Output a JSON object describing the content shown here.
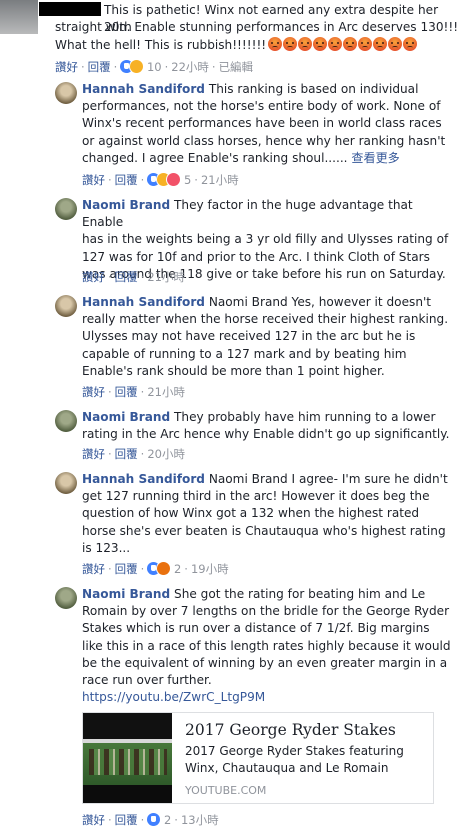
{
  "top_comment": {
    "text_line1": "This is pathetic! Winx not earned any extra despite her 20th",
    "text_line2": "straight win. Enable stunning performances in Arc deserves 130!!!!!!",
    "text_line3": "What the hell! This is rubbish!!!!!!!",
    "like": "讚好",
    "reply": "回覆",
    "reaction_count": "10",
    "time": "22小時",
    "edited": "已編輯"
  },
  "replies": [
    {
      "author": "Hannah Sandiford",
      "lines": [
        "This ranking is based on individual",
        "performances, not the horse's entire body of work. None of",
        "Winx's recent performances have been in world class races",
        "or against world class horses, hence why her ranking hasn't",
        "changed. I agree Enable's ranking shoul......"
      ],
      "see_more": "查看更多",
      "like": "讚好",
      "reply": "回覆",
      "reaction_count": "5",
      "time": "21小時"
    },
    {
      "author": "Naomi Brand",
      "lines": [
        "They factor in the huge advantage that Enable",
        "has in the weights being a 3 yr old filly and Ulysses rating of",
        "127 was for 10f and prior to the Arc. I think Cloth of Stars",
        "was around the 118 give or take before his run on Saturday."
      ],
      "like": "讚好",
      "reply": "回覆",
      "time": "21小時"
    },
    {
      "author": "Hannah Sandiford",
      "lines": [
        "Naomi Brand Yes, however it doesn't",
        "really matter when the horse received their highest ranking.",
        "Ulysses may not have received 127 in the arc but he is",
        "capable of running to a 127 mark and by beating him",
        "Enable's rank should be more than 1 point higher."
      ],
      "like": "讚好",
      "reply": "回覆",
      "time": "21小時"
    },
    {
      "author": "Naomi Brand",
      "lines": [
        "They probably have him running to a lower",
        "rating in the Arc hence why Enable didn't go up significantly."
      ],
      "like": "讚好",
      "reply": "回覆",
      "time": "20小時"
    },
    {
      "author": "Hannah Sandiford",
      "lines": [
        "Naomi Brand I agree- I'm sure he didn't",
        "get 127 running third in the arc! However it does beg the",
        "question of how Winx got a 132 when the highest rated",
        "horse she's ever beaten is Chautauqua who's highest rating",
        "is 123..."
      ],
      "like": "讚好",
      "reply": "回覆",
      "reaction_count": "2",
      "time": "19小時"
    },
    {
      "author": "Naomi Brand",
      "lines": [
        "She got the rating for beating him and Le",
        "Romain by over 7 lengths on the bridle for the George Ryder",
        "Stakes which is run over a distance of 7 1/2f. Big margins",
        "like this in a race of this length rates highly because it would",
        "be the equivalent of winning by an even greater margin in a",
        "race run over further."
      ],
      "link": "https://youtu.be/ZwrC_LtgP9M",
      "like": "讚好",
      "reply": "回覆",
      "reaction_count": "2",
      "time": "13小時"
    }
  ],
  "link_card": {
    "title": "2017 George Ryder Stakes",
    "description_line1": "2017 George Ryder Stakes featuring",
    "description_line2": "Winx, Chautauqua and Le Romain",
    "domain": "YOUTUBE.COM"
  }
}
